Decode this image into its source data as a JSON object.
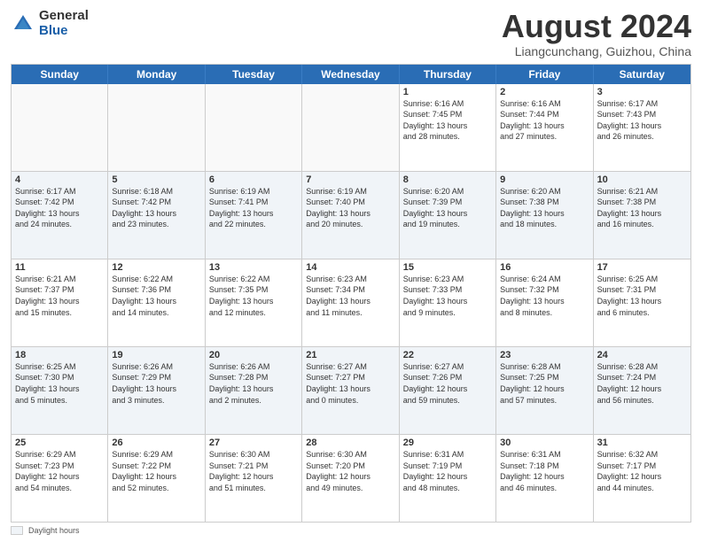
{
  "logo": {
    "general": "General",
    "blue": "Blue"
  },
  "header": {
    "month": "August 2024",
    "location": "Liangcunchang, Guizhou, China"
  },
  "weekdays": [
    "Sunday",
    "Monday",
    "Tuesday",
    "Wednesday",
    "Thursday",
    "Friday",
    "Saturday"
  ],
  "footer": {
    "label": "Daylight hours"
  },
  "rows": [
    {
      "alt": false,
      "cells": [
        {
          "day": "",
          "info": ""
        },
        {
          "day": "",
          "info": ""
        },
        {
          "day": "",
          "info": ""
        },
        {
          "day": "",
          "info": ""
        },
        {
          "day": "1",
          "info": "Sunrise: 6:16 AM\nSunset: 7:45 PM\nDaylight: 13 hours\nand 28 minutes."
        },
        {
          "day": "2",
          "info": "Sunrise: 6:16 AM\nSunset: 7:44 PM\nDaylight: 13 hours\nand 27 minutes."
        },
        {
          "day": "3",
          "info": "Sunrise: 6:17 AM\nSunset: 7:43 PM\nDaylight: 13 hours\nand 26 minutes."
        }
      ]
    },
    {
      "alt": true,
      "cells": [
        {
          "day": "4",
          "info": "Sunrise: 6:17 AM\nSunset: 7:42 PM\nDaylight: 13 hours\nand 24 minutes."
        },
        {
          "day": "5",
          "info": "Sunrise: 6:18 AM\nSunset: 7:42 PM\nDaylight: 13 hours\nand 23 minutes."
        },
        {
          "day": "6",
          "info": "Sunrise: 6:19 AM\nSunset: 7:41 PM\nDaylight: 13 hours\nand 22 minutes."
        },
        {
          "day": "7",
          "info": "Sunrise: 6:19 AM\nSunset: 7:40 PM\nDaylight: 13 hours\nand 20 minutes."
        },
        {
          "day": "8",
          "info": "Sunrise: 6:20 AM\nSunset: 7:39 PM\nDaylight: 13 hours\nand 19 minutes."
        },
        {
          "day": "9",
          "info": "Sunrise: 6:20 AM\nSunset: 7:38 PM\nDaylight: 13 hours\nand 18 minutes."
        },
        {
          "day": "10",
          "info": "Sunrise: 6:21 AM\nSunset: 7:38 PM\nDaylight: 13 hours\nand 16 minutes."
        }
      ]
    },
    {
      "alt": false,
      "cells": [
        {
          "day": "11",
          "info": "Sunrise: 6:21 AM\nSunset: 7:37 PM\nDaylight: 13 hours\nand 15 minutes."
        },
        {
          "day": "12",
          "info": "Sunrise: 6:22 AM\nSunset: 7:36 PM\nDaylight: 13 hours\nand 14 minutes."
        },
        {
          "day": "13",
          "info": "Sunrise: 6:22 AM\nSunset: 7:35 PM\nDaylight: 13 hours\nand 12 minutes."
        },
        {
          "day": "14",
          "info": "Sunrise: 6:23 AM\nSunset: 7:34 PM\nDaylight: 13 hours\nand 11 minutes."
        },
        {
          "day": "15",
          "info": "Sunrise: 6:23 AM\nSunset: 7:33 PM\nDaylight: 13 hours\nand 9 minutes."
        },
        {
          "day": "16",
          "info": "Sunrise: 6:24 AM\nSunset: 7:32 PM\nDaylight: 13 hours\nand 8 minutes."
        },
        {
          "day": "17",
          "info": "Sunrise: 6:25 AM\nSunset: 7:31 PM\nDaylight: 13 hours\nand 6 minutes."
        }
      ]
    },
    {
      "alt": true,
      "cells": [
        {
          "day": "18",
          "info": "Sunrise: 6:25 AM\nSunset: 7:30 PM\nDaylight: 13 hours\nand 5 minutes."
        },
        {
          "day": "19",
          "info": "Sunrise: 6:26 AM\nSunset: 7:29 PM\nDaylight: 13 hours\nand 3 minutes."
        },
        {
          "day": "20",
          "info": "Sunrise: 6:26 AM\nSunset: 7:28 PM\nDaylight: 13 hours\nand 2 minutes."
        },
        {
          "day": "21",
          "info": "Sunrise: 6:27 AM\nSunset: 7:27 PM\nDaylight: 13 hours\nand 0 minutes."
        },
        {
          "day": "22",
          "info": "Sunrise: 6:27 AM\nSunset: 7:26 PM\nDaylight: 12 hours\nand 59 minutes."
        },
        {
          "day": "23",
          "info": "Sunrise: 6:28 AM\nSunset: 7:25 PM\nDaylight: 12 hours\nand 57 minutes."
        },
        {
          "day": "24",
          "info": "Sunrise: 6:28 AM\nSunset: 7:24 PM\nDaylight: 12 hours\nand 56 minutes."
        }
      ]
    },
    {
      "alt": false,
      "cells": [
        {
          "day": "25",
          "info": "Sunrise: 6:29 AM\nSunset: 7:23 PM\nDaylight: 12 hours\nand 54 minutes."
        },
        {
          "day": "26",
          "info": "Sunrise: 6:29 AM\nSunset: 7:22 PM\nDaylight: 12 hours\nand 52 minutes."
        },
        {
          "day": "27",
          "info": "Sunrise: 6:30 AM\nSunset: 7:21 PM\nDaylight: 12 hours\nand 51 minutes."
        },
        {
          "day": "28",
          "info": "Sunrise: 6:30 AM\nSunset: 7:20 PM\nDaylight: 12 hours\nand 49 minutes."
        },
        {
          "day": "29",
          "info": "Sunrise: 6:31 AM\nSunset: 7:19 PM\nDaylight: 12 hours\nand 48 minutes."
        },
        {
          "day": "30",
          "info": "Sunrise: 6:31 AM\nSunset: 7:18 PM\nDaylight: 12 hours\nand 46 minutes."
        },
        {
          "day": "31",
          "info": "Sunrise: 6:32 AM\nSunset: 7:17 PM\nDaylight: 12 hours\nand 44 minutes."
        }
      ]
    }
  ]
}
